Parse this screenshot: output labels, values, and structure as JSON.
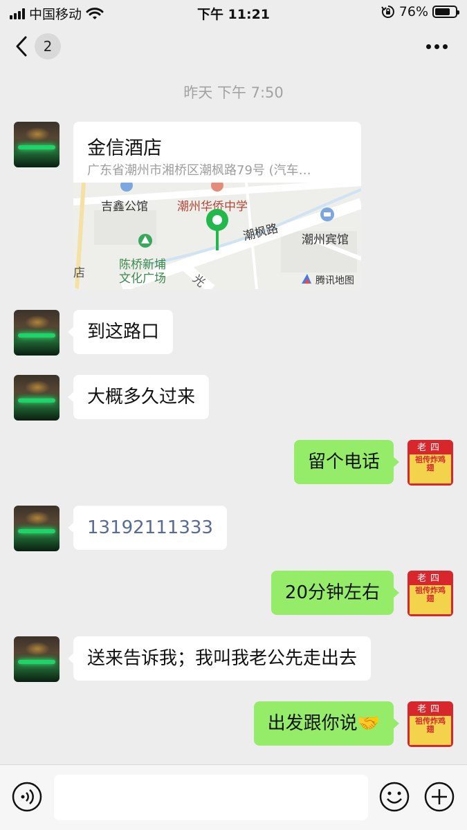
{
  "status_bar": {
    "carrier": "中国移动",
    "time": "下午 11:21",
    "battery_percent": "76%",
    "battery_level": 0.76,
    "icons": [
      "signal-icon",
      "wifi-icon",
      "rotation-lock-icon",
      "battery-icon"
    ]
  },
  "nav": {
    "unread_count": "2",
    "icons": [
      "back-chevron-icon",
      "more-icon"
    ]
  },
  "timestamp": "昨天 下午 7:50",
  "location_card": {
    "title": "金信酒店",
    "address": "广东省潮州市湘桥区潮枫路79号 (汽车…",
    "map_labels": {
      "poi_1": "吉鑫公馆",
      "poi_2": "潮州华侨中学",
      "road": "潮枫路",
      "poi_3": "潮州宾馆",
      "poi_4_line1": "陈桥新埔",
      "poi_4_line2": "文化广场",
      "edge_1": "店",
      "edge_2": "光",
      "provider": "腾讯地图"
    }
  },
  "messages": [
    {
      "side": "left",
      "text": "到这路口"
    },
    {
      "side": "left",
      "text": "大概多久过来"
    },
    {
      "side": "right",
      "text": "留个电话"
    },
    {
      "side": "left",
      "text": "13192111333"
    },
    {
      "side": "right",
      "text": "20分钟左右"
    },
    {
      "side": "left",
      "text": "送来告诉我；我叫我老公先走出去"
    },
    {
      "side": "right",
      "text": "出发跟你说🤝"
    }
  ],
  "avatar_shop": {
    "top_text": "老四",
    "body_text": "祖传炸鸡翅"
  },
  "input_bar": {
    "value": "",
    "icons": [
      "voice-icon",
      "emoji-icon",
      "plus-icon"
    ]
  }
}
